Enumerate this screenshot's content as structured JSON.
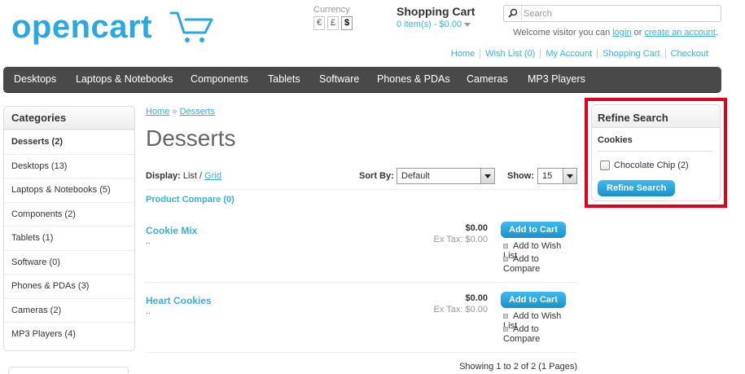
{
  "header": {
    "logo_text": "opencart",
    "currency": {
      "label": "Currency",
      "options": [
        "€",
        "£",
        "$"
      ],
      "active": "$"
    },
    "cart": {
      "title": "Shopping Cart",
      "summary": "0 item(s) - $0.00"
    },
    "search": {
      "placeholder": "Search"
    },
    "welcome": {
      "prefix": "Welcome visitor you can",
      "login": "login",
      "or": "or",
      "create": "create an account",
      "suffix": "."
    },
    "links": [
      "Home",
      "Wish List (0)",
      "My Account",
      "Shopping Cart",
      "Checkout"
    ]
  },
  "menu": [
    "Desktops",
    "Laptops & Notebooks",
    "Components",
    "Tablets",
    "Software",
    "Phones & PDAs",
    "Cameras",
    "MP3 Players"
  ],
  "categories": {
    "title": "Categories",
    "items": [
      {
        "label": "Desserts (2)",
        "active": true
      },
      {
        "label": "Desktops (13)"
      },
      {
        "label": "Laptops & Notebooks (5)"
      },
      {
        "label": "Components (2)"
      },
      {
        "label": "Tablets (1)"
      },
      {
        "label": "Software (0)"
      },
      {
        "label": "Phones & PDAs (3)"
      },
      {
        "label": "Cameras (2)"
      },
      {
        "label": "MP3 Players (4)"
      }
    ]
  },
  "content": {
    "breadcrumb": {
      "home": "Home",
      "sep": "»",
      "current": "Desserts"
    },
    "title": "Desserts",
    "display": {
      "label": "Display:",
      "list": "List",
      "sep": "/",
      "grid": "Grid"
    },
    "sort": {
      "label": "Sort By:",
      "value": "Default"
    },
    "show": {
      "label": "Show:",
      "value": "15"
    },
    "compare": "Product Compare (0)",
    "products": [
      {
        "name": "Cookie Mix",
        "desc": "..",
        "price": "$0.00",
        "extax": "Ex Tax: $0.00",
        "add": "Add to Cart",
        "wish": "Add to Wish List",
        "compare": "Add to Compare"
      },
      {
        "name": "Heart Cookies",
        "desc": "..",
        "price": "$0.00",
        "extax": "Ex Tax: $0.00",
        "add": "Add to Cart",
        "wish": "Add to Wish List",
        "compare": "Add to Compare"
      }
    ],
    "pagination": "Showing 1 to 2 of 2 (1 Pages)"
  },
  "refine": {
    "title": "Refine Search",
    "group": "Cookies",
    "option": "Chocolate Chip (2)",
    "button": "Refine Search",
    "highlight_color": "#e0001b"
  },
  "colors": {
    "accent": "#38B0E3",
    "menu_bg": "#494949",
    "button": "#1e9fd8"
  }
}
